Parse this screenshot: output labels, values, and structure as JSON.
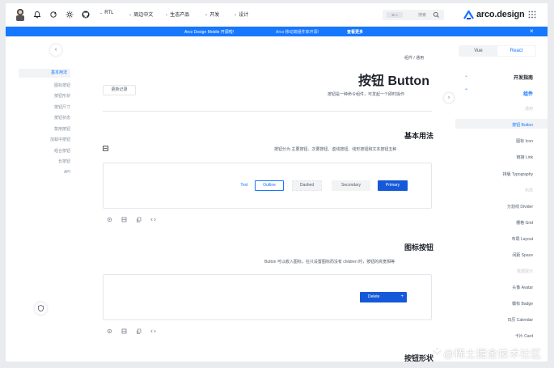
{
  "header": {
    "nav": [
      {
        "label": "RTL",
        "icon": "rtl-icon"
      },
      {
        "label": "周边中文"
      },
      {
        "label": "生态产品"
      },
      {
        "label": "开发"
      },
      {
        "label": "设计"
      }
    ],
    "search": {
      "shortcut": "⌘ K",
      "placeholder": "搜索"
    },
    "logo_text": "arco.design"
  },
  "banner": {
    "text1": "Arco Design Mobile 开源啦!",
    "text2": "Arco 移动端组件库开源!",
    "link": "查看更多"
  },
  "left_nav": {
    "items": [
      "基本用法",
      "图标按钮",
      "按钮形状",
      "按钮尺寸",
      "按钮状态",
      "禁用按钮",
      "加载中按钮",
      "组合按钮",
      "长按钮",
      "API"
    ],
    "active_index": 0
  },
  "main": {
    "breadcrumb": "组件  /  通用",
    "title": "按钮 Button",
    "subtitle": "按钮是一种命令组件，可发起一个即时操作",
    "changelog": "更新记录",
    "sections": [
      {
        "title": "基本用法",
        "desc": "按钮分为 主要按钮、次要按钮、虚线按钮、线形按钮和文本按钮五种",
        "buttons": [
          "Text",
          "Outline",
          "Dashed",
          "Secondary",
          "Primary"
        ]
      },
      {
        "title": "图标按钮",
        "desc": "Button 可以嵌入图标，在只设置图标而没有 children 时，按钮的高宽相等",
        "buttons": [
          "Delete"
        ]
      },
      {
        "title": "按钮形状"
      }
    ]
  },
  "right_nav": {
    "tabs": [
      "Vue",
      "React"
    ],
    "active_tab": 1,
    "items": [
      {
        "label": "开发指南",
        "kind": "section"
      },
      {
        "label": "组件",
        "kind": "section-active"
      },
      {
        "label": "通用",
        "kind": "group"
      },
      {
        "label": "按钮 Button",
        "kind": "active"
      },
      {
        "label": "图标 Icon",
        "kind": "item"
      },
      {
        "label": "链接 Link",
        "kind": "item"
      },
      {
        "label": "排版 Typography",
        "kind": "item"
      },
      {
        "label": "布局",
        "kind": "group"
      },
      {
        "label": "分割线 Divider",
        "kind": "item"
      },
      {
        "label": "栅格 Grid",
        "kind": "item"
      },
      {
        "label": "布局 Layout",
        "kind": "item"
      },
      {
        "label": "间距 Space",
        "kind": "item"
      },
      {
        "label": "数据展示",
        "kind": "group"
      },
      {
        "label": "头像 Avatar",
        "kind": "item"
      },
      {
        "label": "徽标 Badge",
        "kind": "item"
      },
      {
        "label": "日历 Calendar",
        "kind": "item"
      },
      {
        "label": "卡片 Card",
        "kind": "item"
      }
    ]
  },
  "watermark": "@稀土掘金技术社区",
  "colors": {
    "primary": "#1677ff",
    "banner": "#1677ff"
  }
}
